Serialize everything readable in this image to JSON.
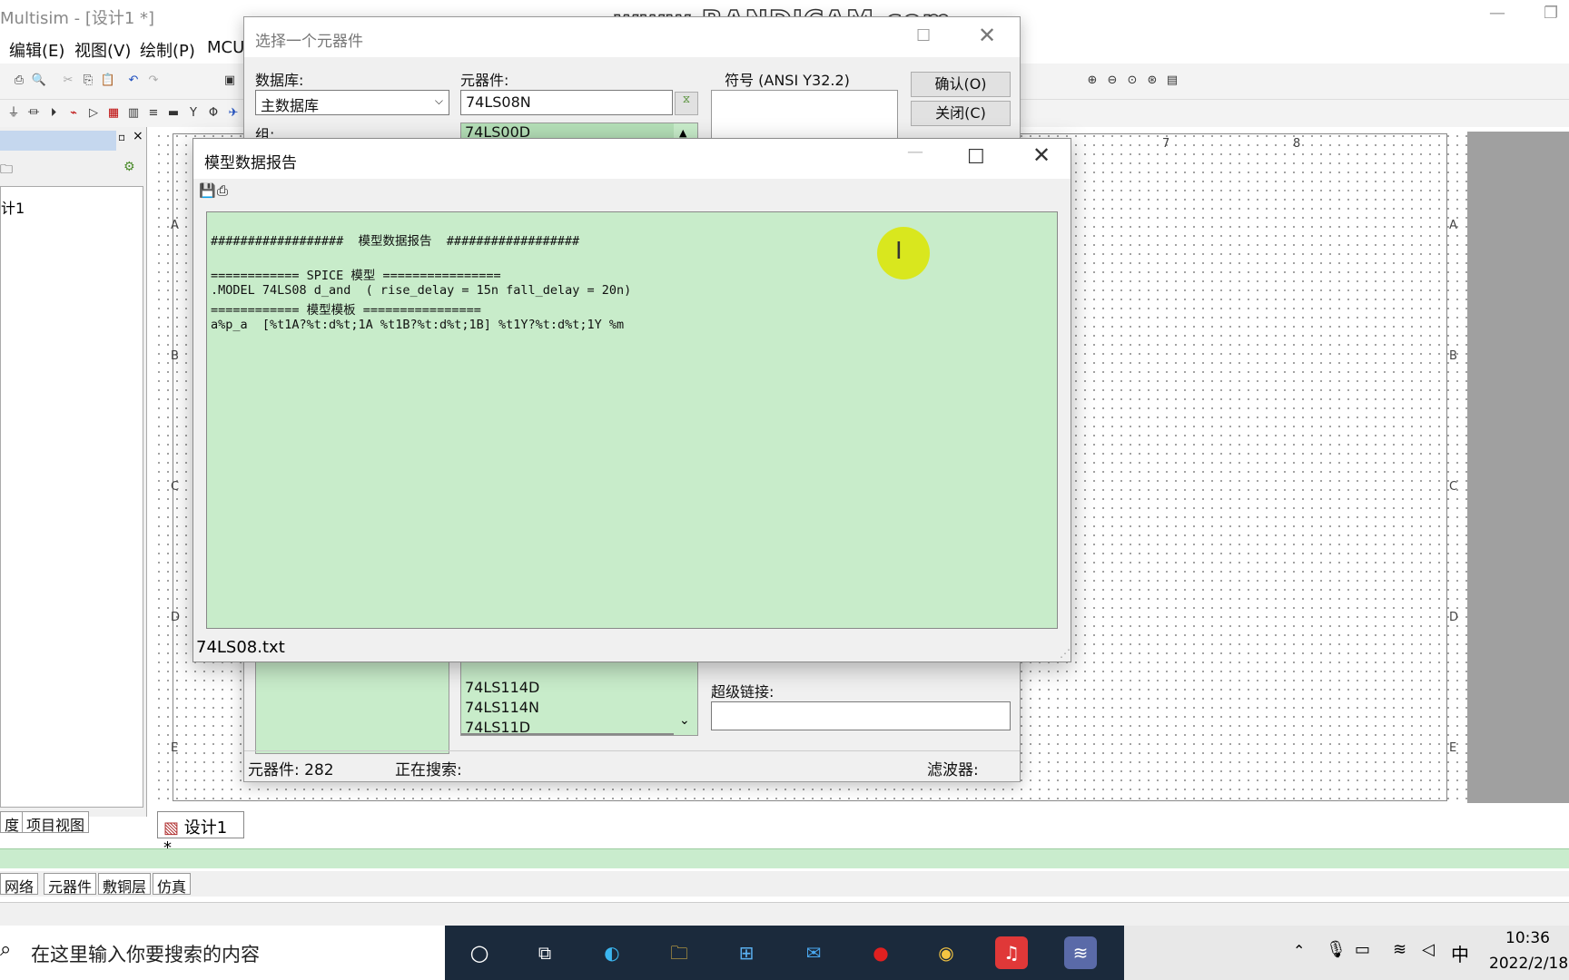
{
  "app": {
    "title": "Multisim - [设计1 *]",
    "watermark": "www.BANDICAM.com",
    "menu": [
      "编辑(E)",
      "视图(V)",
      "绘制(P)",
      "MCU"
    ]
  },
  "select_dialog": {
    "title": "选择一个元器件",
    "database_label": "数据库:",
    "database_value": "主数据库",
    "group_label": "组:",
    "component_label": "元器件:",
    "component_value": "74LS08N",
    "symbol_label": "符号 (ANSI Y32.2)",
    "confirm_button": "确认(O)",
    "close_button": "关闭(C)",
    "list_top_item": "74LS00D",
    "list_visible_items": [
      "74LS114D",
      "74LS114N",
      "74LS11D"
    ],
    "hyperlink_label": "超级链接:",
    "status_count": "元器件:  282",
    "status_search": "正在搜索:",
    "status_filter": "滤波器:"
  },
  "report": {
    "title": "模型数据报告",
    "lines": [
      "##################  模型数据报告  ##################",
      "",
      "============ SPICE 模型 ================",
      ".MODEL 74LS08 d_and  ( rise_delay = 15n fall_delay = 20n)",
      "============ 模型模板 ================",
      "a%p_a  [%t1A?%t:d%t;1A %t1B?%t:d%t;1B] %t1Y?%t:d%t;1Y %m"
    ],
    "filename": "74LS08.txt"
  },
  "canvas": {
    "col_labels": [
      "7",
      "8"
    ],
    "row_labels": [
      "A",
      "B",
      "C",
      "D",
      "E"
    ],
    "doc_tab": "设计1 *"
  },
  "left_panel": {
    "tree_item": "计1",
    "tabs": [
      "度",
      "项目视图"
    ]
  },
  "bottom_tabs": [
    "网络",
    "元器件",
    "敷铜层",
    "仿真"
  ],
  "taskbar": {
    "search_placeholder": "在这里输入你要搜索的内容",
    "time": "10:36",
    "date": "2022/2/18",
    "ime": "中"
  }
}
